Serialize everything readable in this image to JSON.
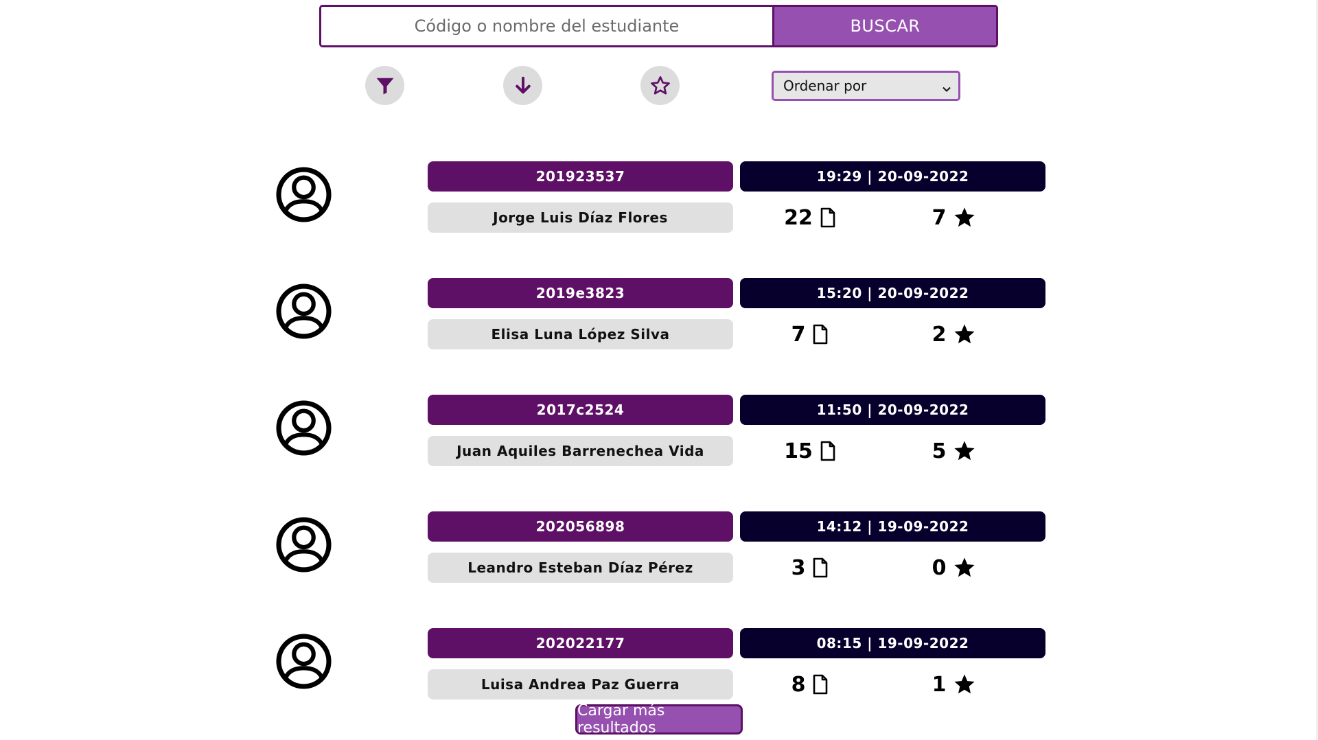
{
  "search": {
    "placeholder": "Código o nombre del estudiante",
    "button_label": "BUSCAR"
  },
  "toolbar": {
    "filter_icon": "filter-icon",
    "download_icon": "arrow-down-icon",
    "favorite_icon": "star-outline-icon",
    "sort_label": "Ordenar por"
  },
  "students": [
    {
      "code": "201923537",
      "datetime": "19:29 | 20-09-2022",
      "name": "Jorge Luis Díaz Flores",
      "documents": "22",
      "stars": "7"
    },
    {
      "code": "2019e3823",
      "datetime": "15:20 | 20-09-2022",
      "name": "Elisa Luna López Silva",
      "documents": "7",
      "stars": "2"
    },
    {
      "code": "2017c2524",
      "datetime": "11:50 | 20-09-2022",
      "name": "Juan Aquiles Barrenechea Vida",
      "documents": "15",
      "stars": "5"
    },
    {
      "code": "202056898",
      "datetime": "14:12 | 19-09-2022",
      "name": "Leandro Esteban Díaz Pérez",
      "documents": "3",
      "stars": "0"
    },
    {
      "code": "202022177",
      "datetime": "08:15 | 19-09-2022",
      "name": "Luisa Andrea Paz Guerra",
      "documents": "8",
      "stars": "1"
    }
  ],
  "footer": {
    "load_more_label": "Cargar más resultados"
  },
  "colors": {
    "primary_purple": "#5e1066",
    "light_purple": "#9650b0",
    "dark_navy": "#08002c",
    "name_bg": "#e0e0e0",
    "tool_bg": "#dcdcdc"
  }
}
